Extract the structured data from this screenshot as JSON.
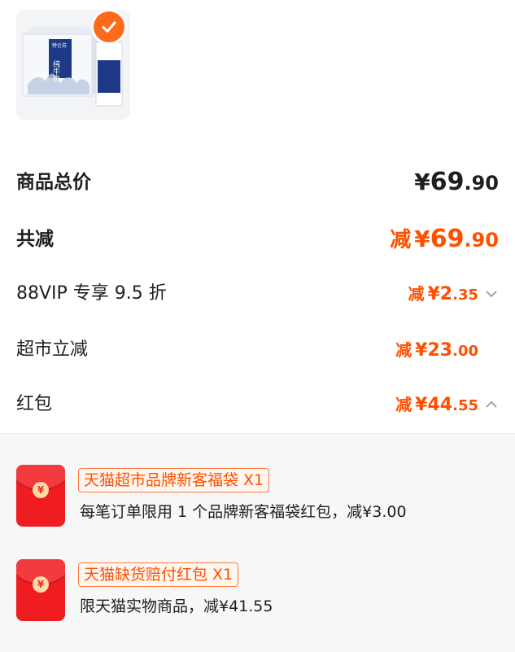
{
  "product": {
    "box_brand": "特仑苏",
    "box_name": "纯牛奶",
    "selected": true
  },
  "summary": [
    {
      "label": "商品总价",
      "prefix": "",
      "yen": "¥",
      "int": "69",
      "dec": ".90"
    },
    {
      "label": "共减",
      "prefix": "减",
      "yen": "¥",
      "int": "69",
      "dec": ".90"
    }
  ],
  "discounts": [
    {
      "label": "88VIP 专享 9.5 折",
      "prefix": "减",
      "yen": "¥",
      "int": "2",
      "dec": ".35",
      "chevron": "chevron-down-icon"
    },
    {
      "label": "超市立减",
      "prefix": "减",
      "yen": "¥",
      "int": "23",
      "dec": ".00",
      "chevron": ""
    },
    {
      "label": "红包",
      "prefix": "减",
      "yen": "¥",
      "int": "44",
      "dec": ".55",
      "chevron": "chevron-up-icon"
    }
  ],
  "red_packets": [
    {
      "icon": "red-packet-icon",
      "coin": "¥",
      "tag": "天猫超市品牌新客福袋 X1",
      "desc": "每笔订单限用 1 个品牌新客福袋红包，减¥3.00"
    },
    {
      "icon": "red-packet-icon",
      "coin": "¥",
      "tag": "天猫缺货赔付红包 X1",
      "desc": "限天猫实物商品，减¥41.55"
    }
  ],
  "colors": {
    "accent": "#ff5000",
    "check": "#ff6a1a",
    "packet": "#ef1c22"
  }
}
